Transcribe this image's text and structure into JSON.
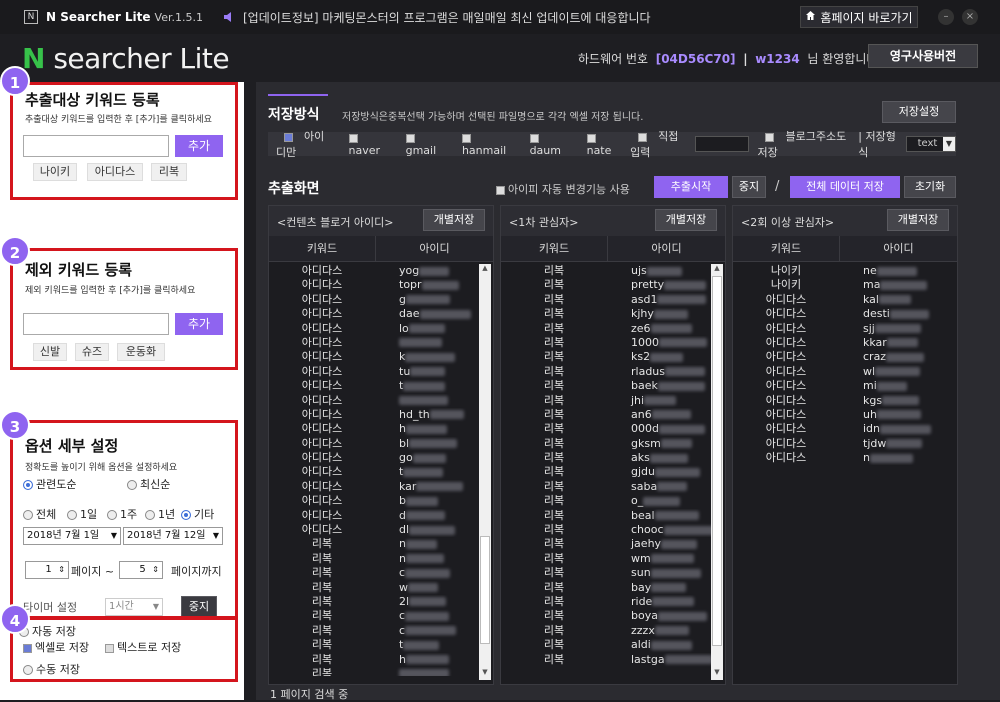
{
  "app": {
    "logo_letter": "N",
    "title": "N Searcher Lite",
    "version": "Ver.1.5.1",
    "notice": "[업데이트정보] 마케팅몬스터의 프로그램은 매일매일 최신 업데이트에 대응합니다",
    "home_button": "홈페이지 바로가기",
    "minimize": "–",
    "close": "×"
  },
  "brand": {
    "n": "N",
    "name": " searcher Lite",
    "hw_label": "하드웨어 번호",
    "hw_code": "[04D56C70]",
    "sep": "|",
    "user": "w1234",
    "welcome": "님 환영합니다!",
    "perm_button": "영구사용버전"
  },
  "left": {
    "s1": {
      "badge": "1",
      "title": "추출대상 키워드 등록",
      "desc": "추출대상 키워드를 입력한 후 [추가]를 클릭하세요",
      "add": "추가",
      "tags": [
        "나이키",
        "아디다스",
        "리복"
      ]
    },
    "s2": {
      "badge": "2",
      "title": "제외 키워드 등록",
      "desc": "제외 키워드를 입력한 후 [추가]를 클릭하세요",
      "add": "추가",
      "tags": [
        "신발",
        "슈즈",
        "운동화"
      ]
    },
    "s3": {
      "badge": "3",
      "title": "옵션 세부 설정",
      "desc": "정확도를 높이기 위해 옵션을 설정하세요",
      "sort": [
        "관련도순",
        "최신순"
      ],
      "period": [
        "전체",
        "1일",
        "1주",
        "1년",
        "기타"
      ],
      "date_from": "2018년  7월  1일",
      "date_to": "2018년  7월 12일",
      "page_from": "1",
      "page_label": "페이지 ~",
      "page_to": "5",
      "page_until": "페이지까지",
      "timer_label": "타이머 설정",
      "timer_value": "1시간",
      "stop": "중지"
    },
    "s4": {
      "badge": "4",
      "auto": "자동 저장",
      "excel": "엑셀로 저장",
      "text": "텍스트로 저장",
      "manual": "수동 저장"
    }
  },
  "right": {
    "save": {
      "title": "저장방식",
      "desc": "저장방식은중복선택 가능하며 선택된 파일명으로 각각 엑셀 저장 됩니다.",
      "settings": "저장설정",
      "options": [
        "아이디만",
        "naver",
        "gmail",
        "hanmail",
        "daum",
        "nate",
        "직접입력"
      ],
      "blog_addr": "블로그주소도 저장",
      "format_label": "| 저장형식",
      "format_value": "text"
    },
    "extract": {
      "title": "추출화면",
      "ip_change": "아이피 자동 변경기능 사용",
      "start": "추출시작",
      "stop": "중지",
      "slash": "/",
      "save_all": "전체 데이터 저장",
      "reset": "초기화"
    },
    "panels": [
      {
        "title": "<컨텐츠 블로거 아이디>",
        "save": "개별저장",
        "col_k": "키워드",
        "col_v": "아이디",
        "rows": [
          [
            "아디다스",
            "yog"
          ],
          [
            "아디다스",
            "topr"
          ],
          [
            "아디다스",
            "g"
          ],
          [
            "아디다스",
            "dae"
          ],
          [
            "아디다스",
            "lo"
          ],
          [
            "아디다스",
            ""
          ],
          [
            "아디다스",
            "k"
          ],
          [
            "아디다스",
            "tu"
          ],
          [
            "아디다스",
            "t"
          ],
          [
            "아디다스",
            ""
          ],
          [
            "아디다스",
            "hd_th"
          ],
          [
            "아디다스",
            "h"
          ],
          [
            "아디다스",
            "bl"
          ],
          [
            "아디다스",
            "go"
          ],
          [
            "아디다스",
            "t"
          ],
          [
            "아디다스",
            "kar"
          ],
          [
            "아디다스",
            "b"
          ],
          [
            "아디다스",
            "d"
          ],
          [
            "아디다스",
            "dl"
          ],
          [
            "리복",
            "n"
          ],
          [
            "리복",
            "n"
          ],
          [
            "리복",
            "c"
          ],
          [
            "리복",
            "w"
          ],
          [
            "리복",
            "2l"
          ],
          [
            "리복",
            "c"
          ],
          [
            "리복",
            "c"
          ],
          [
            "리복",
            "t"
          ],
          [
            "리복",
            "h"
          ],
          [
            "리복",
            ""
          ]
        ]
      },
      {
        "title": "<1차 관심자>",
        "save": "개별저장",
        "col_k": "키워드",
        "col_v": "아이디",
        "rows": [
          [
            "리복",
            "ujs"
          ],
          [
            "리복",
            "pretty"
          ],
          [
            "리복",
            "asd1"
          ],
          [
            "리복",
            "kjhy"
          ],
          [
            "리복",
            "ze6"
          ],
          [
            "리복",
            "1000"
          ],
          [
            "리복",
            "ks2"
          ],
          [
            "리복",
            "rladus"
          ],
          [
            "리복",
            "baek"
          ],
          [
            "리복",
            "jhi"
          ],
          [
            "리복",
            "an6"
          ],
          [
            "리복",
            "000d"
          ],
          [
            "리복",
            "gksm"
          ],
          [
            "리복",
            "aks"
          ],
          [
            "리복",
            "gjdu"
          ],
          [
            "리복",
            "saba"
          ],
          [
            "리복",
            "o_"
          ],
          [
            "리복",
            "beal"
          ],
          [
            "리복",
            "chooc"
          ],
          [
            "리복",
            "jaehy"
          ],
          [
            "리복",
            "wm"
          ],
          [
            "리복",
            "sun"
          ],
          [
            "리복",
            "bay"
          ],
          [
            "리복",
            "ride"
          ],
          [
            "리복",
            "boya"
          ],
          [
            "리복",
            "zzzx"
          ],
          [
            "리복",
            "aldi"
          ],
          [
            "리복",
            "lastga"
          ]
        ]
      },
      {
        "title": "<2회 이상 관심자>",
        "save": "개별저장",
        "col_k": "키워드",
        "col_v": "아이디",
        "rows": [
          [
            "나이키",
            "ne"
          ],
          [
            "나이키",
            "ma"
          ],
          [
            "아디다스",
            "kal"
          ],
          [
            "아디다스",
            "desti"
          ],
          [
            "아디다스",
            "sjj"
          ],
          [
            "아디다스",
            "kkar"
          ],
          [
            "아디다스",
            "craz"
          ],
          [
            "아디다스",
            "wl"
          ],
          [
            "아디다스",
            "mi"
          ],
          [
            "아디다스",
            "kgs"
          ],
          [
            "아디다스",
            "uh"
          ],
          [
            "아디다스",
            "idn"
          ],
          [
            "아디다스",
            "tjdw"
          ],
          [
            "아디다스",
            "n"
          ]
        ]
      }
    ],
    "status": "1 페이지 검색 중"
  }
}
